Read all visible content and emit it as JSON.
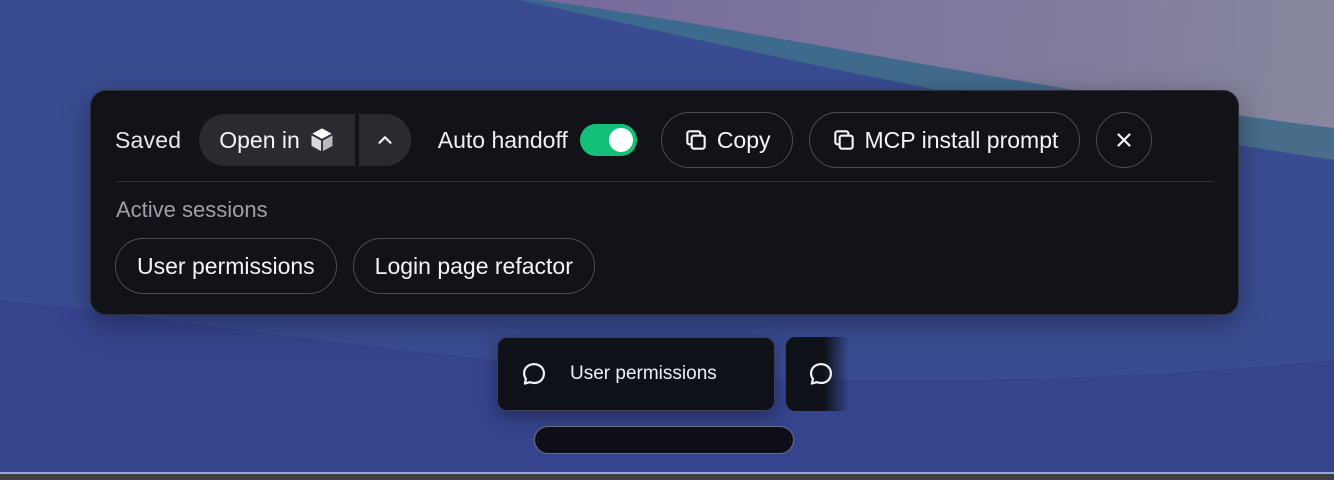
{
  "toolbar": {
    "saved_label": "Saved",
    "open_in_label": "Open in",
    "open_in_icon": "cube-icon",
    "menu_icon": "chevron-up-icon",
    "auto_handoff_label": "Auto handoff",
    "auto_handoff_on": true,
    "copy_label": "Copy",
    "copy_icon": "copy-icon",
    "mcp_label": "MCP install prompt",
    "mcp_icon": "copy-icon",
    "close_icon": "close-icon"
  },
  "sessions": {
    "heading": "Active sessions",
    "items": [
      {
        "label": "User permissions"
      },
      {
        "label": "Login page refactor"
      }
    ]
  },
  "dock": {
    "cards": [
      {
        "label": "User permissions",
        "icon": "chat-bubble-icon"
      },
      {
        "label": "",
        "icon": "chat-bubble-icon"
      }
    ]
  },
  "colors": {
    "toggle_on": "#12c07a",
    "panel_bg": "#111318",
    "wallpaper_blue": "#384c91",
    "wallpaper_teal": "#3e6b8c",
    "wallpaper_mauve": "#8a7aa0"
  }
}
